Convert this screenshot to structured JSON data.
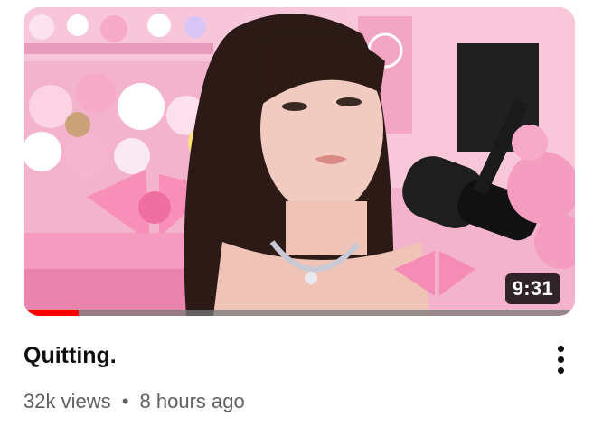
{
  "video": {
    "title": "Quitting.",
    "duration": "9:31",
    "views": "32k views",
    "separator": "•",
    "age": "8 hours ago",
    "watch_progress_fraction": 0.1
  },
  "thumbnail": {
    "subject": "woman with long dark hair and bangs speaking into a black microphone",
    "background": "pink room filled with plush toys and pink bows"
  },
  "menu": {
    "icon": "more-vert-icon"
  },
  "colors": {
    "progress": "#ff0000",
    "title": "#0f0f0f",
    "meta": "#606060",
    "room_pink": "#f4b6cf"
  }
}
